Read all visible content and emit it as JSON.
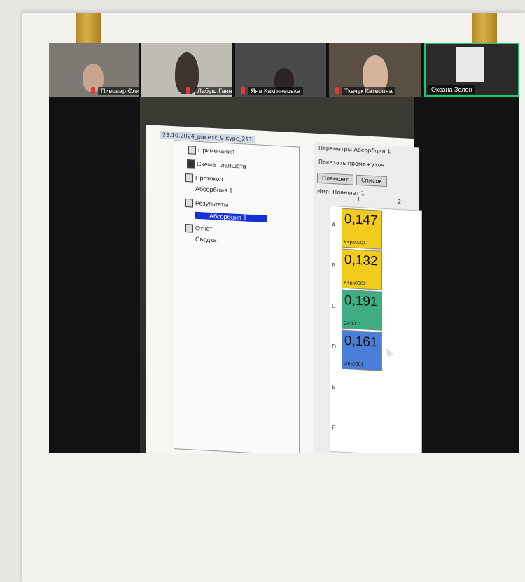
{
  "participants": [
    {
      "name": "Пивовар Єлизавета",
      "muted": true
    },
    {
      "name": "Лабуш Ганна",
      "muted": true
    },
    {
      "name": "Яна Кам'янецька",
      "muted": true
    },
    {
      "name": "Ткачук Катерина",
      "muted": true
    },
    {
      "name": "Оксана Зелен",
      "muted": false
    }
  ],
  "app": {
    "document_tab": "23.10.2024_ракетс_9 курс_211",
    "tree": {
      "items": [
        "Примечания",
        "Схема планшета",
        "Протокол",
        "Абсорбция 1",
        "Результаты",
        "Абсорбция 1",
        "Отчет",
        "Сводка"
      ]
    },
    "params_title": "Параметры Абсорбция 1",
    "show_checkbox_label": "Показать промежуточ",
    "view_tabs": [
      "Планшет",
      "Список"
    ],
    "name_label": "Имя: Планшет 1",
    "columns": [
      "1",
      "2"
    ],
    "rows": [
      "A",
      "B",
      "C",
      "D",
      "E",
      "F"
    ],
    "wells": [
      {
        "value": "0,147",
        "sample": "K+ps0001",
        "color": "#f2cc1c"
      },
      {
        "value": "0,132",
        "sample": "K+ps0002",
        "color": "#f2cc1c"
      },
      {
        "value": "0,191",
        "sample": "Ctr0001",
        "color": "#3fae84"
      },
      {
        "value": "0,161",
        "sample": "Obs0001",
        "color": "#4a7fd8"
      }
    ]
  }
}
